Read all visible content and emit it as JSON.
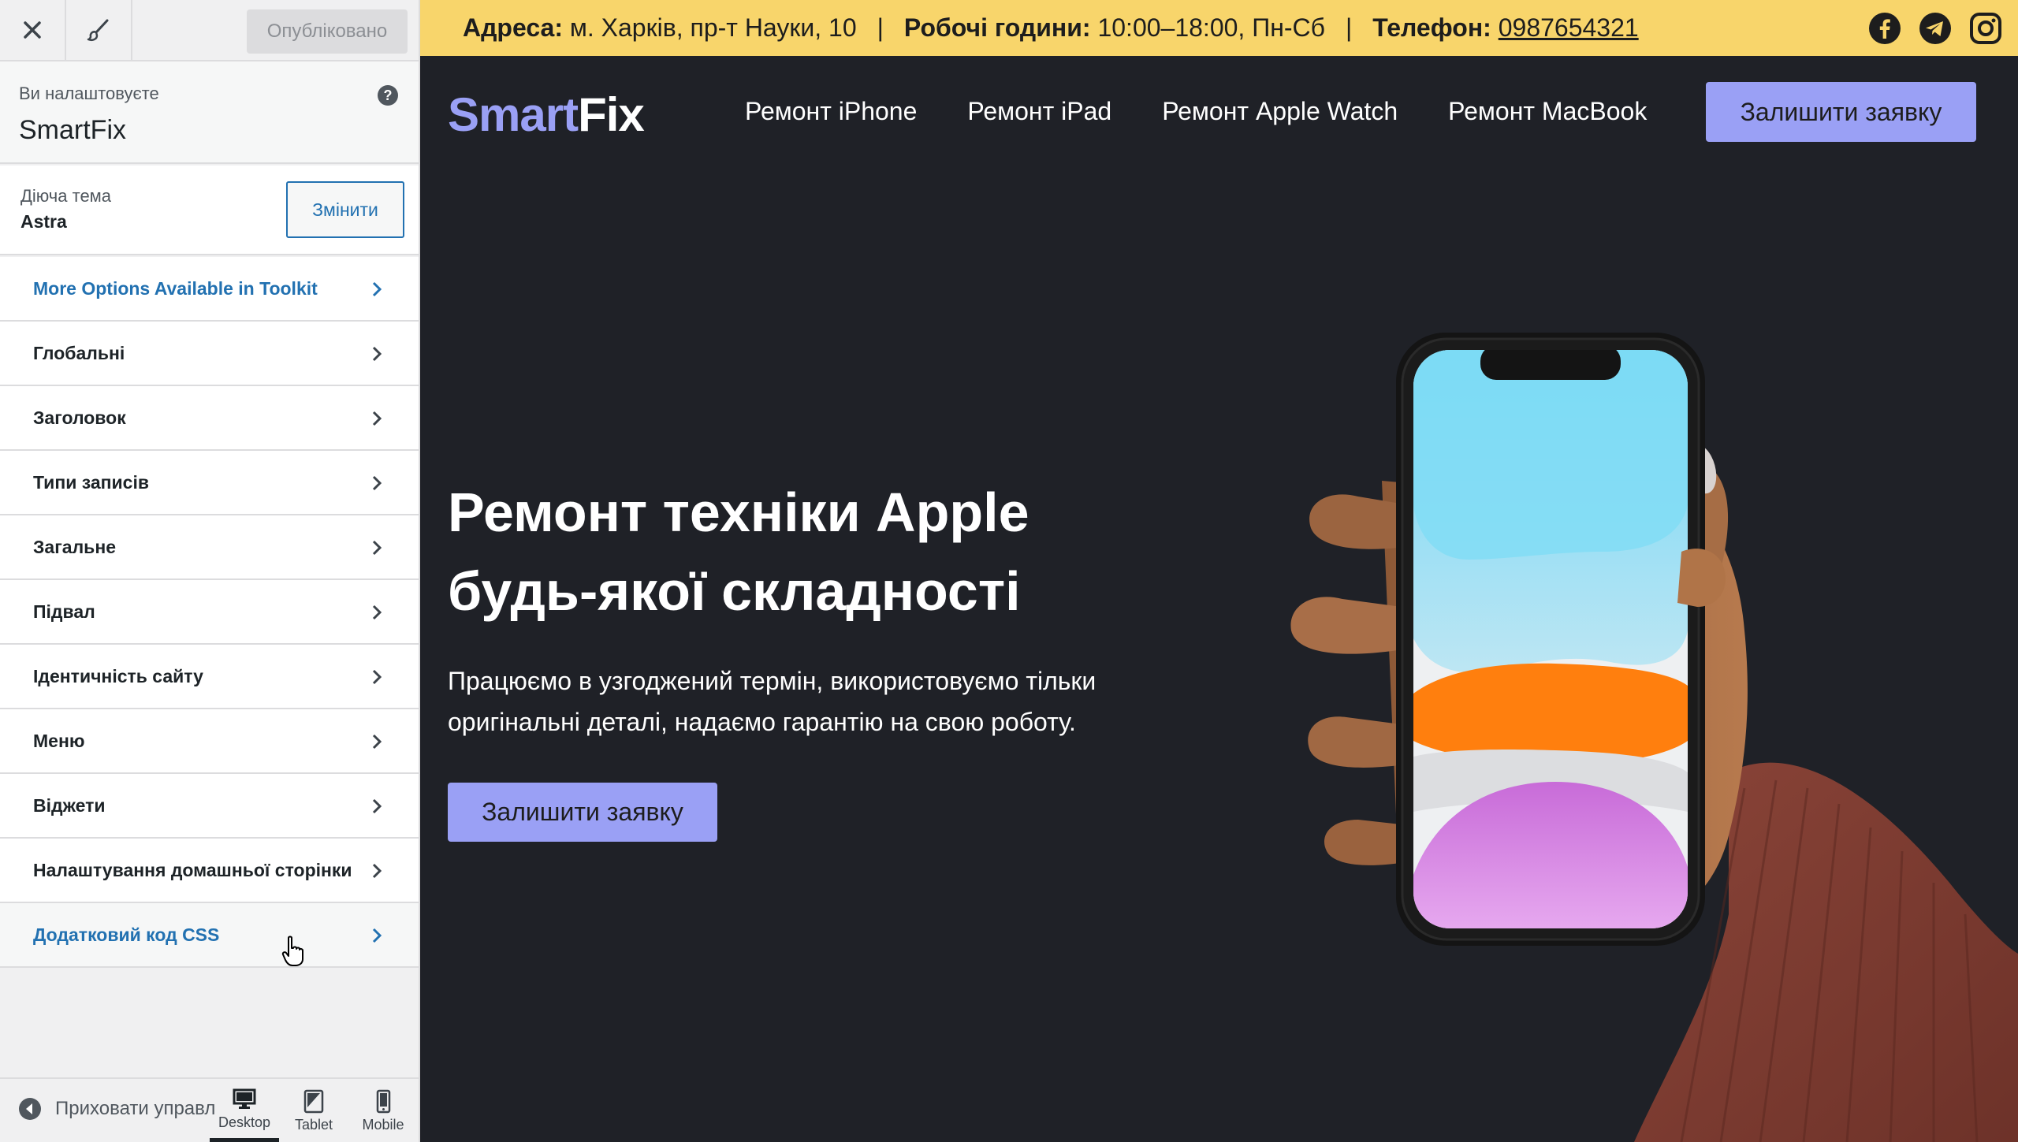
{
  "customizer": {
    "publish_label": "Опубліковано",
    "info": {
      "pre": "Ви налаштовуєте",
      "site_title": "SmartFix"
    },
    "theme": {
      "label": "Діюча тема",
      "name": "Astra",
      "change_label": "Змінити"
    },
    "menu_items": [
      {
        "label": "More Options Available in Toolkit"
      },
      {
        "label": "Глобальні"
      },
      {
        "label": "Заголовок"
      },
      {
        "label": "Типи записів"
      },
      {
        "label": "Загальне"
      },
      {
        "label": "Підвал"
      },
      {
        "label": "Ідентичність сайту"
      },
      {
        "label": "Меню"
      },
      {
        "label": "Віджети"
      },
      {
        "label": "Налаштування домашньої сторінки"
      },
      {
        "label": "Додатковий код CSS"
      }
    ],
    "footer": {
      "collapse_label": "Приховати управління",
      "devices": {
        "desktop": "Desktop",
        "tablet": "Tablet",
        "mobile": "Mobile"
      }
    },
    "colors": {
      "link_blue": "#2271b1"
    }
  },
  "site": {
    "infobar": {
      "address_label": "Адреса:",
      "address_value": "м. Харків, пр-т Науки, 10",
      "hours_label": "Робочі години:",
      "hours_value": "10:00–18:00, Пн-Сб",
      "phone_label": "Телефон:",
      "phone_value": "0987654321",
      "separator": "|"
    },
    "socials": [
      "facebook-icon",
      "telegram-icon",
      "instagram-icon"
    ],
    "logo": {
      "part1": "Smart",
      "part2": "Fix"
    },
    "nav": [
      "Ремонт iPhone",
      "Ремонт iPad",
      "Ремонт Apple Watch",
      "Ремонт MacBook"
    ],
    "nav_cta": "Залишити заявку",
    "hero": {
      "title_line1": "Ремонт техніки Apple",
      "title_line2": "будь-якої складності",
      "text_line1": "Працюємо в узгоджений термін, використовуємо тільки",
      "text_line2": "оригінальні деталі, надаємо гарантію на свою роботу.",
      "cta": "Залишити заявку"
    },
    "colors": {
      "accent": "#9aa0f5",
      "infobar_bg": "#f8d56b",
      "bg": "#1f2127"
    }
  }
}
